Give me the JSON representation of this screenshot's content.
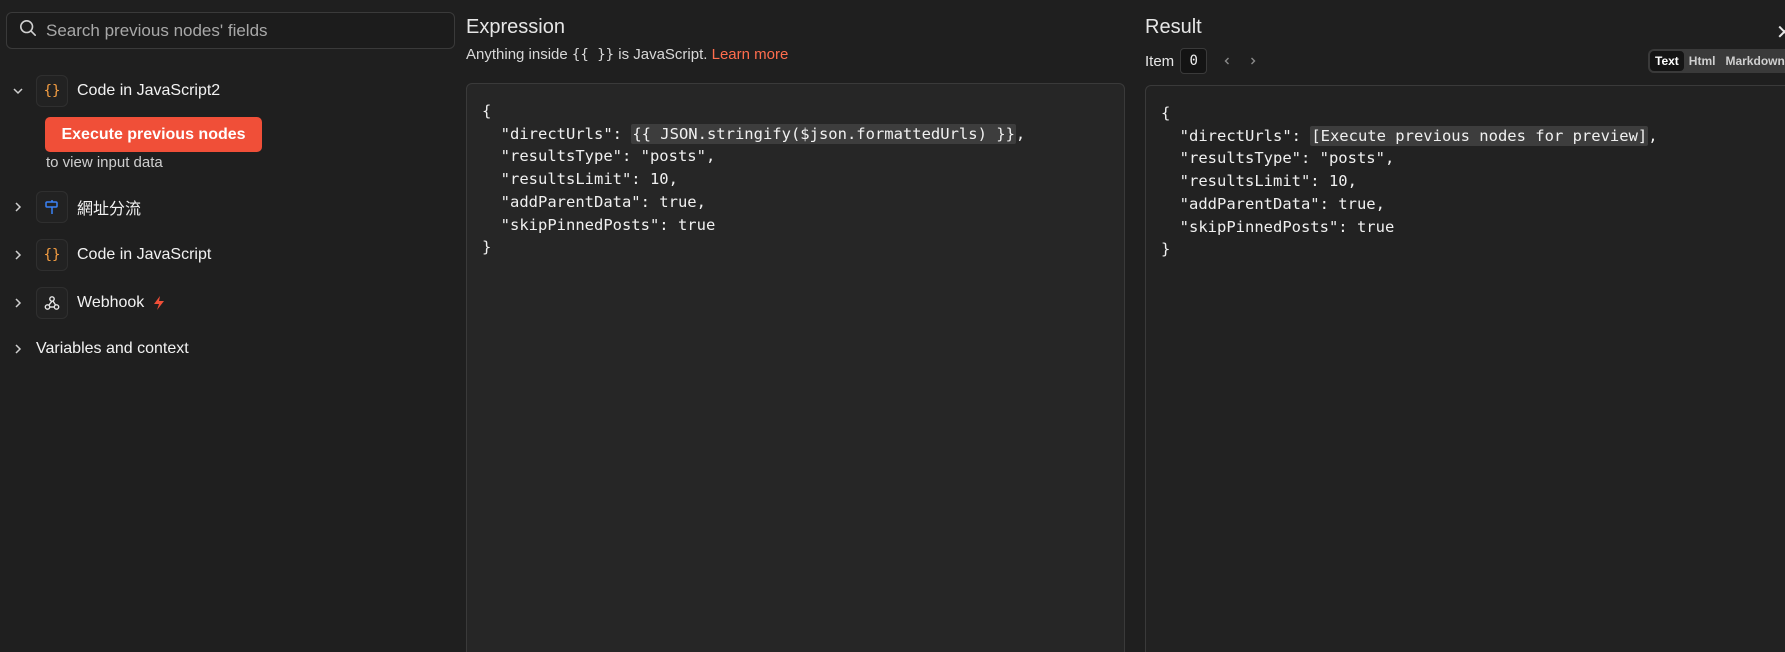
{
  "search": {
    "placeholder": "Search previous nodes' fields"
  },
  "nodes": [
    {
      "label": "Code in JavaScript2",
      "icon": "code-braces-icon",
      "expanded": true
    },
    {
      "label": "網址分流",
      "icon": "signpost-icon",
      "expanded": false
    },
    {
      "label": "Code in JavaScript",
      "icon": "code-braces-icon",
      "expanded": false
    },
    {
      "label": "Webhook",
      "icon": "webhook-icon",
      "expanded": false,
      "trigger": true
    }
  ],
  "execute": {
    "button_label": "Execute previous nodes",
    "hint": "to view input data"
  },
  "variables": {
    "label": "Variables and context"
  },
  "expression": {
    "title": "Expression",
    "subtitle_prefix": "Anything inside",
    "subtitle_braces": "{{ }}",
    "subtitle_suffix": "is JavaScript.",
    "learn_more": "Learn more",
    "code_lines": [
      "{",
      "  \"directUrls\": ",
      "{{ JSON.stringify($json.formattedUrls) }}",
      ",",
      "  \"resultsType\": \"posts\",",
      "  \"resultsLimit\": 10,",
      "  \"addParentData\": true,",
      "  \"skipPinnedPosts\": true",
      "}"
    ]
  },
  "result": {
    "title": "Result",
    "item_label": "Item",
    "item_value": "0",
    "formats": [
      "Text",
      "Html",
      "Markdown"
    ],
    "active_format": "Text",
    "code_lines": [
      "{",
      "  \"directUrls\": ",
      "[Execute previous nodes for preview]",
      ",",
      "  \"resultsType\": \"posts\",",
      "  \"resultsLimit\": 10,",
      "  \"addParentData\": true,",
      "  \"skipPinnedPosts\": true",
      "}"
    ]
  },
  "colors": {
    "accent": "#f04f38",
    "link": "#ff6d4d",
    "code_icon": "#f59e42",
    "signpost_icon": "#3b82f6",
    "bolt": "#f04f38"
  }
}
